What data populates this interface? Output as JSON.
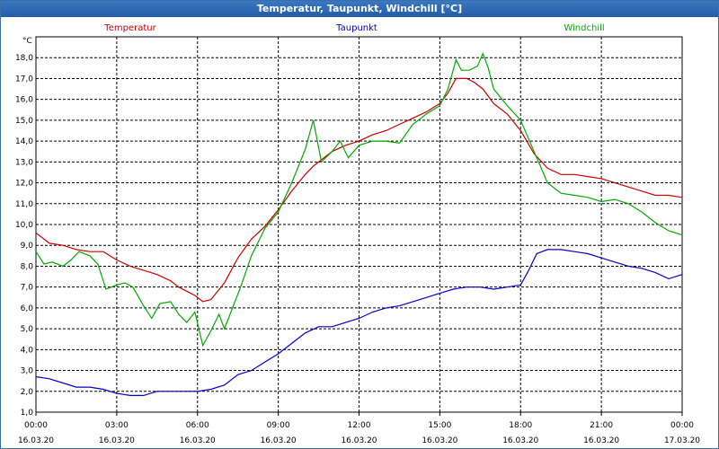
{
  "window": {
    "title": "Temperatur, Taupunkt, Windchill [°C]"
  },
  "chart_data": {
    "type": "line",
    "title": "Temperatur, Taupunkt, Windchill [°C]",
    "ylabel": "°C",
    "xlabel": "",
    "ylim": [
      1.0,
      19.0
    ],
    "xlim": [
      0,
      24
    ],
    "grid": true,
    "y_ticks": [
      "1,0",
      "2,0",
      "3,0",
      "4,0",
      "5,0",
      "6,0",
      "7,0",
      "8,0",
      "9,0",
      "10,0",
      "11,0",
      "12,0",
      "13,0",
      "14,0",
      "15,0",
      "16,0",
      "17,0",
      "18,0"
    ],
    "x_ticks": [
      {
        "time": "00:00",
        "date": "16.03.20"
      },
      {
        "time": "03:00",
        "date": "16.03.20"
      },
      {
        "time": "06:00",
        "date": "16.03.20"
      },
      {
        "time": "09:00",
        "date": "16.03.20"
      },
      {
        "time": "12:00",
        "date": "16.03.20"
      },
      {
        "time": "15:00",
        "date": "16.03.20"
      },
      {
        "time": "18:00",
        "date": "16.03.20"
      },
      {
        "time": "21:00",
        "date": "16.03.20"
      },
      {
        "time": "00:00",
        "date": "17.03.20"
      }
    ],
    "series": [
      {
        "name": "Temperatur",
        "color": "#cc0000",
        "x": [
          0,
          0.5,
          1.0,
          1.5,
          2.0,
          2.5,
          3.0,
          3.5,
          4.0,
          4.5,
          5.0,
          5.3,
          5.6,
          5.9,
          6.2,
          6.5,
          7.0,
          7.5,
          8.0,
          8.5,
          9.0,
          9.5,
          10.0,
          10.3,
          10.6,
          11.0,
          11.5,
          12.0,
          12.5,
          13.0,
          13.5,
          14.0,
          14.5,
          15.0,
          15.3,
          15.6,
          16.0,
          16.3,
          16.6,
          17.0,
          17.5,
          18.0,
          18.5,
          19.0,
          19.5,
          20.0,
          20.5,
          21.0,
          21.5,
          22.0,
          22.5,
          23.0,
          23.5,
          24.0
        ],
        "y": [
          9.6,
          9.1,
          9.0,
          8.8,
          8.7,
          8.7,
          8.3,
          8.0,
          7.8,
          7.6,
          7.3,
          7.0,
          6.8,
          6.6,
          6.3,
          6.4,
          7.2,
          8.4,
          9.3,
          9.9,
          10.7,
          11.6,
          12.4,
          12.8,
          13.1,
          13.5,
          13.8,
          14.0,
          14.3,
          14.5,
          14.8,
          15.1,
          15.4,
          15.8,
          16.3,
          17.0,
          17.0,
          16.8,
          16.5,
          15.8,
          15.3,
          14.5,
          13.4,
          12.7,
          12.4,
          12.4,
          12.3,
          12.2,
          12.0,
          11.8,
          11.6,
          11.4,
          11.4,
          11.3
        ]
      },
      {
        "name": "Taupunkt",
        "color": "#0000cc",
        "x": [
          0,
          0.5,
          1.0,
          1.5,
          2.0,
          2.5,
          3.0,
          3.5,
          4.0,
          4.5,
          5.0,
          5.5,
          6.0,
          6.5,
          7.0,
          7.5,
          8.0,
          8.5,
          9.0,
          9.5,
          10.0,
          10.5,
          11.0,
          11.5,
          12.0,
          12.5,
          13.0,
          13.5,
          14.0,
          14.5,
          15.0,
          15.5,
          16.0,
          16.5,
          17.0,
          17.5,
          18.0,
          18.3,
          18.6,
          19.0,
          19.5,
          20.0,
          20.5,
          21.0,
          21.5,
          22.0,
          22.5,
          23.0,
          23.5,
          24.0
        ],
        "y": [
          2.7,
          2.6,
          2.4,
          2.2,
          2.2,
          2.1,
          1.9,
          1.8,
          1.8,
          2.0,
          2.0,
          2.0,
          2.0,
          2.1,
          2.3,
          2.8,
          3.0,
          3.4,
          3.8,
          4.3,
          4.8,
          5.1,
          5.1,
          5.3,
          5.5,
          5.8,
          6.0,
          6.1,
          6.3,
          6.5,
          6.7,
          6.9,
          7.0,
          7.0,
          6.9,
          7.0,
          7.1,
          7.8,
          8.6,
          8.8,
          8.8,
          8.7,
          8.6,
          8.4,
          8.2,
          8.0,
          7.9,
          7.7,
          7.4,
          7.6
        ]
      },
      {
        "name": "Windchill",
        "color": "#00aa00",
        "x": [
          0,
          0.3,
          0.6,
          1.0,
          1.3,
          1.6,
          2.0,
          2.3,
          2.6,
          3.0,
          3.3,
          3.6,
          4.0,
          4.3,
          4.6,
          5.0,
          5.3,
          5.6,
          5.9,
          6.2,
          6.5,
          6.8,
          7.0,
          7.3,
          7.6,
          8.0,
          8.5,
          9.0,
          9.5,
          10.0,
          10.3,
          10.6,
          11.0,
          11.3,
          11.6,
          12.0,
          12.5,
          13.0,
          13.5,
          14.0,
          14.5,
          15.0,
          15.3,
          15.6,
          15.8,
          16.1,
          16.4,
          16.6,
          16.8,
          17.0,
          17.5,
          18.0,
          18.5,
          19.0,
          19.5,
          20.0,
          20.5,
          21.0,
          21.5,
          22.0,
          22.5,
          23.0,
          23.5,
          24.0
        ],
        "y": [
          8.7,
          8.1,
          8.2,
          8.0,
          8.3,
          8.7,
          8.5,
          8.1,
          6.9,
          7.1,
          7.2,
          7.0,
          6.1,
          5.5,
          6.2,
          6.3,
          5.7,
          5.3,
          5.8,
          4.2,
          4.9,
          5.7,
          5.0,
          6.0,
          7.0,
          8.5,
          9.8,
          10.6,
          12.0,
          13.6,
          15.0,
          13.0,
          13.5,
          14.0,
          13.2,
          13.8,
          14.0,
          14.0,
          13.9,
          14.8,
          15.3,
          15.7,
          16.5,
          17.9,
          17.4,
          17.4,
          17.6,
          18.2,
          17.5,
          16.5,
          15.7,
          15.0,
          13.5,
          12.0,
          11.5,
          11.4,
          11.3,
          11.1,
          11.2,
          11.0,
          10.6,
          10.1,
          9.7,
          9.5
        ]
      }
    ]
  }
}
